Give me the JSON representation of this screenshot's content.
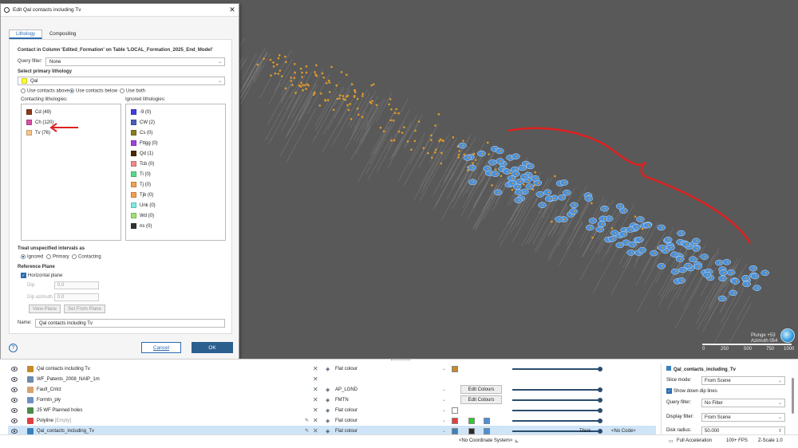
{
  "dialog": {
    "title": "Edit Qal contacts including Tv",
    "tabs": [
      "Lithology",
      "Compositing"
    ],
    "heading": "Contact in Column 'Edited_Formation' on Table 'LOCAL_Formation_2025_End_Model'",
    "query_filter_label": "Query filter:",
    "query_filter_value": "None",
    "primary_label": "Select primary lithology",
    "primary_value": "Qal",
    "primary_color": "#ffff33",
    "use_above": "Use contacts above",
    "use_below": "Use contacts below",
    "use_both": "Use both",
    "contacting_label": "Contacting lithologies:",
    "ignored_label": "Ignored lithologies:",
    "contacting": [
      {
        "label": "Cd (49)",
        "color": "#8b3a1a"
      },
      {
        "label": "Ch (120)",
        "color": "#d94fa4"
      },
      {
        "label": "Tv (76)",
        "color": "#f7c58a"
      }
    ],
    "ignored": [
      {
        "label": "-9 (0)",
        "color": "#4040e0"
      },
      {
        "label": "CW (2)",
        "color": "#4a5fb8"
      },
      {
        "label": "Cs (0)",
        "color": "#8a7a20"
      },
      {
        "label": "Fttgg (0)",
        "color": "#a040e0"
      },
      {
        "label": "Qd (1)",
        "color": "#4a2a08"
      },
      {
        "label": "Tcb (0)",
        "color": "#f08a8a"
      },
      {
        "label": "Ti (0)",
        "color": "#5ad890"
      },
      {
        "label": "Tj (0)",
        "color": "#f0a050"
      },
      {
        "label": "Tjb (0)",
        "color": "#f0a050"
      },
      {
        "label": "Unk (0)",
        "color": "#80e8e0"
      },
      {
        "label": "Wd (0)",
        "color": "#a0e070"
      },
      {
        "label": "ns (0)",
        "color": "#333333"
      }
    ],
    "treat_label": "Treat unspecified intervals as",
    "treat_options": [
      "Ignored",
      "Primary",
      "Contacting"
    ],
    "ref_plane_label": "Reference Plane",
    "horizontal_label": "Horizontal plane",
    "dip_label": "Dip:",
    "dip_value": "0.0",
    "dip_az_label": "Dip azimuth:",
    "dip_az_value": "0.0",
    "view_plane_btn": "View Plane",
    "set_from_plane_btn": "Set From Plane",
    "name_label": "Name:",
    "name_value": "Qal contacts including Tv",
    "cancel": "Cancel",
    "ok": "OK"
  },
  "scene": {
    "plunge": "Plunge +53",
    "azimuth": "Azimuth 054",
    "scale_ticks": [
      "0",
      "250",
      "500",
      "750",
      "1000"
    ]
  },
  "layers": [
    {
      "name": "Qal contacts including Tv",
      "mode": "Flat colour",
      "icon": "contacts-icon",
      "color": "#c58a2a"
    },
    {
      "name": "WF_Patents_2008_NAIP_1m",
      "mode": "",
      "icon": "image-icon",
      "color": "#6a8ab0"
    },
    {
      "name": "Fault_Cntct",
      "mode": "AP_LGND",
      "icon": "fault-icon",
      "color": "#d9a070",
      "btn": "Edit Colours"
    },
    {
      "name": "Formtn_ply",
      "mode": "FMTN",
      "icon": "polygon-icon",
      "color": "#7090c0",
      "btn": "Edit Colours"
    },
    {
      "name": "25 WF Planned holes",
      "mode": "Flat colour",
      "icon": "holes-icon",
      "color": "#4a8a4a"
    },
    {
      "name": "Polyline",
      "suffix": "[Empty]",
      "mode": "Flat colour",
      "icon": "polyline-icon",
      "color": "#e04040"
    },
    {
      "name": "Qal_contacts_including_Tv",
      "mode": "Flat colour",
      "icon": "contacts-icon",
      "color": "#3a80c0",
      "extra": "Thick",
      "extra2": "<No Code>"
    }
  ],
  "props": {
    "title": "Qal_contacts_including_Tv",
    "slice_label": "Slice mode:",
    "slice_value": "From Scene",
    "show_dip": "Show down dip lines",
    "query_label": "Query filter:",
    "query_value": "No Filter",
    "display_label": "Display filter:",
    "display_value": "From Scene",
    "disk_label": "Disk radius:",
    "disk_value": "50.000"
  },
  "status": {
    "coord": "<No Coordinate System>",
    "accel": "Full Acceleration",
    "fps": "100+ FPS",
    "zscale": "Z-Scale 1.0"
  }
}
